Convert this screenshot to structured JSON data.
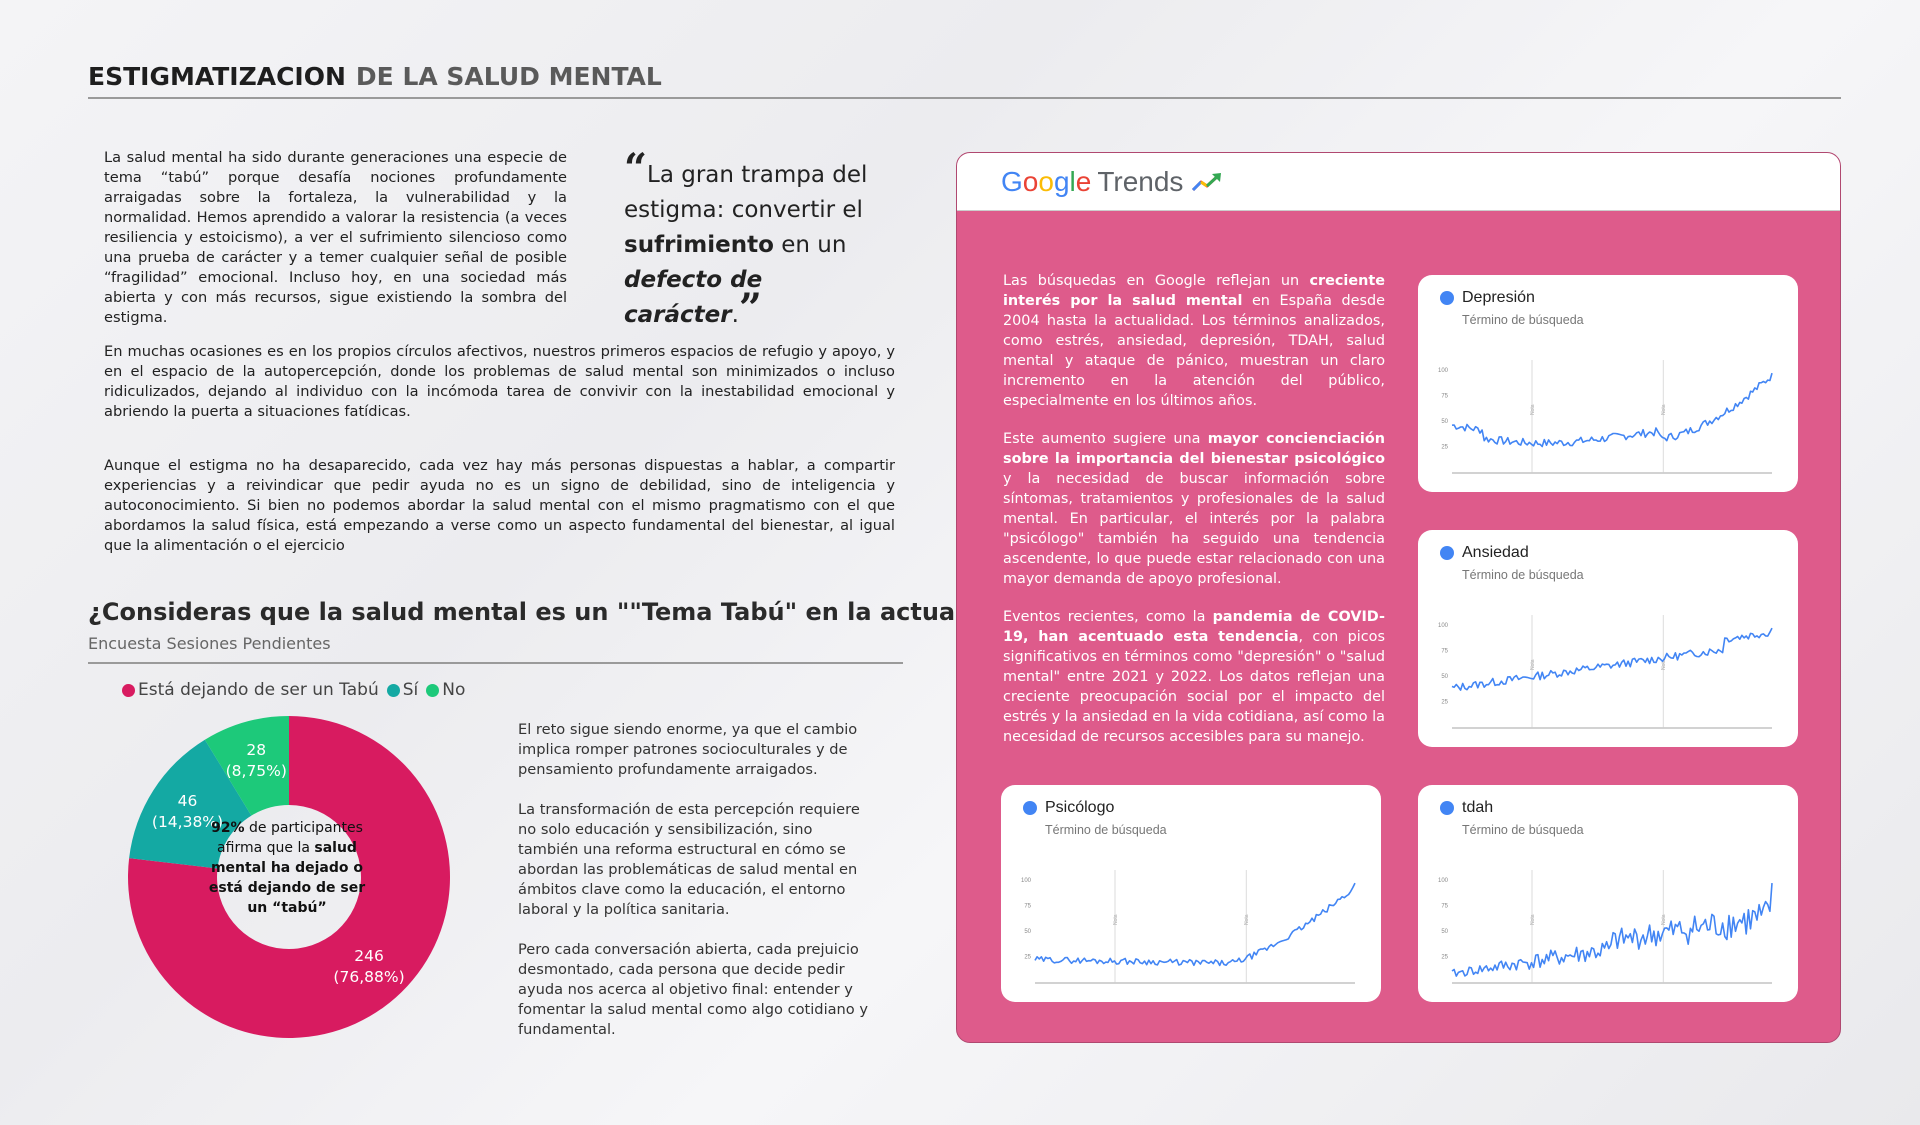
{
  "title": {
    "part1": "ESTIGMATIZACION",
    "part2": "DE LA SALUD MENTAL"
  },
  "intro": {
    "p1": "La salud mental ha sido durante generaciones una especie de tema “tabú” porque desafía nociones profundamente arraigadas sobre la fortaleza, la vulnerabilidad y la normalidad. Hemos aprendido a valorar la resistencia (a veces resiliencia y estoicismo), a ver el sufrimiento silencioso como una prueba de carácter y a temer cualquier señal de  posible “fragilidad” emocional. Incluso hoy, en una sociedad más abierta y con más recursos, sigue existiendo la sombra del estigma.",
    "p2": "En muchas ocasiones es en los propios círculos afectivos, nuestros primeros espacios de refugio y apoyo,  y en el espacio de la autopercepción, donde los problemas de salud mental son minimizados o incluso ridiculizados, dejando al individuo con la incómoda tarea de convivir con la inestabilidad emocional y abriendo la puerta a situaciones fatídicas.",
    "p3": "Aunque el estigma no ha desaparecido, cada vez hay más personas dispuestas a hablar, a compartir experiencias y a reivindicar que pedir ayuda no es un signo de debilidad, sino de inteligencia y autoconocimiento. Si bien no podemos abordar la salud mental con el mismo pragmatismo con el que abordamos la salud física, está empezando a verse como un aspecto fundamental del bienestar, al igual que la alimentación o el ejercicio"
  },
  "quote": {
    "open": "“",
    "a": "La gran trampa del estigma: convertir el ",
    "b": "sufrimiento",
    "c": " en un ",
    "d": "defecto de carácter",
    "e": ".",
    "close": "”"
  },
  "survey": {
    "question": "¿Consideras que la salud mental es un \"\"Tema Tabú\" en la actualidad?",
    "source": "Encuesta Sesiones Pendientes",
    "center": {
      "pct": "92%",
      "a": " de participantes afirma que la ",
      "b": "salud mental ha dejado o está dejando de ser un “tabú”"
    },
    "side1": "El reto sigue siendo enorme, ya que el cambio implica romper patrones socioculturales y de pensamiento profundamente arraigados.",
    "side2": "La transformación de esta percepción requiere no solo educación y sensibilización, sino también una reforma estructural en cómo se abordan las problemáticas de salud mental en ámbitos clave como la educación, el entorno laboral y la política sanitaria.",
    "side3": "Pero cada conversación abierta, cada prejuicio desmontado, cada persona que decide pedir ayuda nos acerca al objetivo final: entender y fomentar la salud mental como algo cotidiano y fundamental."
  },
  "chart_data": [
    {
      "type": "pie",
      "title": "¿Consideras que la salud mental es un \"\"Tema Tabú\" en la actualidad?",
      "categories": [
        "Está dejando de ser un Tabú",
        "Sí",
        "No"
      ],
      "values": [
        246,
        46,
        28
      ],
      "labels": [
        [
          "246",
          "(76,88%)"
        ],
        [
          "46",
          "(14,38%)"
        ],
        [
          "28",
          "(8,75%)"
        ]
      ],
      "colors": [
        "#d81b60",
        "#14a9a3",
        "#1dc97a"
      ],
      "legend": "top"
    },
    {
      "type": "line",
      "title": "Depresión",
      "ylim": [
        0,
        100
      ],
      "yticks": [
        "100",
        "75",
        "50",
        "25"
      ]
    },
    {
      "type": "line",
      "title": "Ansiedad",
      "ylim": [
        0,
        100
      ],
      "yticks": [
        "100",
        "75",
        "50",
        "25"
      ]
    },
    {
      "type": "line",
      "title": "Psicólogo",
      "ylim": [
        0,
        100
      ],
      "yticks": [
        "100",
        "75",
        "50",
        "25"
      ]
    },
    {
      "type": "line",
      "title": "tdah",
      "ylim": [
        0,
        100
      ],
      "yticks": [
        "100",
        "75",
        "50",
        "25"
      ]
    }
  ],
  "trends": {
    "brand": {
      "google": "Google",
      "trends": "Trends"
    },
    "paragraphs": [
      [
        [
          "Las búsquedas en Google reflejan un ",
          false
        ],
        [
          "creciente interés por la salud mental",
          true
        ],
        [
          " en España desde 2004 hasta la actualidad. Los términos analizados, como estrés, ansiedad, depresión, TDAH, salud mental y ataque de pánico, muestran un claro incremento en la atención del público, especialmente en los últimos años.",
          false
        ]
      ],
      [
        [
          "Este aumento sugiere una ",
          false
        ],
        [
          "mayor concienciación sobre la importancia del bienestar psicológico",
          true
        ],
        [
          " y la necesidad de buscar información sobre síntomas, tratamientos y profesionales de la salud mental. En particular, el interés por la palabra \"psicólogo\" también ha seguido una tendencia ascendente, lo que puede estar relacionado con una mayor demanda de apoyo profesional.",
          false
        ]
      ],
      [
        [
          "Eventos recientes, como la ",
          false
        ],
        [
          "pandemia de COVID-19, han acentuado esta tendencia",
          true
        ],
        [
          ", con picos significativos en términos como \"depresión\" o \"salud mental\" entre 2021 y 2022. Los datos reflejan una creciente preocupación social por el impacto del estrés y la ansiedad en la vida cotidiana, así como la necesidad de recursos accesibles para su manejo.",
          false
        ]
      ]
    ],
    "subtitle": "Término de búsqueda",
    "note": "Nota",
    "cards": [
      {
        "term": "Depresión"
      },
      {
        "term": "Ansiedad"
      },
      {
        "term": "Psicólogo"
      },
      {
        "term": "tdah"
      }
    ]
  },
  "colors": {
    "accent": "#de5b8b",
    "line": "#4285f4"
  }
}
